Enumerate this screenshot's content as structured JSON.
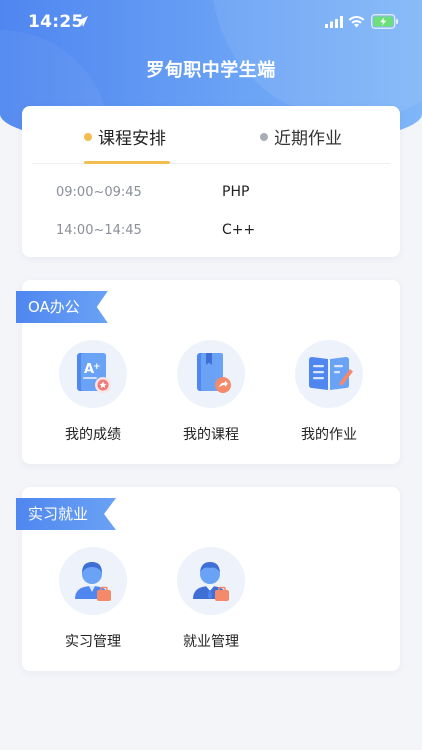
{
  "status_bar": {
    "time": "14:25"
  },
  "header": {
    "title": "罗甸职中学生端"
  },
  "schedule": {
    "tabs": [
      {
        "label": "课程安排",
        "active": true
      },
      {
        "label": "近期作业",
        "active": false
      }
    ],
    "rows": [
      {
        "time": "09:00~09:45",
        "course": "PHP"
      },
      {
        "time": "14:00~14:45",
        "course": "C++"
      }
    ]
  },
  "oa": {
    "section_label": "OA办公",
    "items": [
      {
        "label": "我的成绩",
        "icon": "certificate-icon"
      },
      {
        "label": "我的课程",
        "icon": "course-book-icon"
      },
      {
        "label": "我的作业",
        "icon": "homework-icon"
      }
    ]
  },
  "internship": {
    "section_label": "实习就业",
    "items": [
      {
        "label": "实习管理",
        "icon": "intern-person-icon"
      },
      {
        "label": "就业管理",
        "icon": "employee-person-icon"
      }
    ]
  },
  "colors": {
    "primary_blue": "#4f86f0",
    "accent_yellow": "#f3be4f",
    "background": "#f4f5f9"
  }
}
